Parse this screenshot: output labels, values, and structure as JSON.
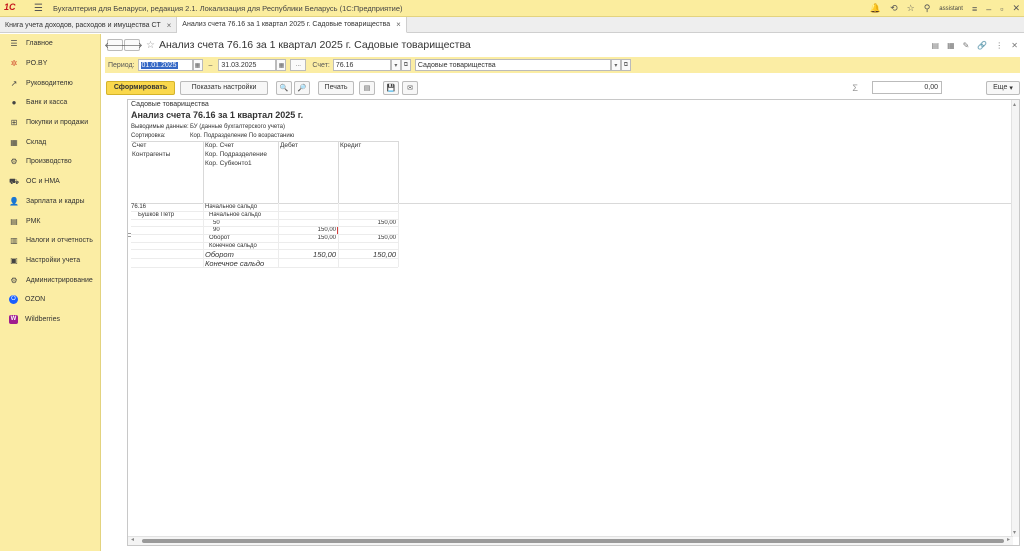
{
  "app": {
    "logo": "1С",
    "title": "Бухгалтерия для Беларуси, редакция 2.1. Локализация для Республики Беларусь   (1С:Предприятие)",
    "user": "assistant"
  },
  "tabs": [
    {
      "label": "Книга учета доходов, расходов и имущества СТ"
    },
    {
      "label": "Анализ счета 76.16 за 1 квартал 2025 г. Садовые товарищества"
    }
  ],
  "sidebar": {
    "items": [
      {
        "label": "Главное",
        "icon": "menu-icon"
      },
      {
        "label": "PO.BY",
        "icon": "sun-icon"
      },
      {
        "label": "Руководителю",
        "icon": "chart-icon"
      },
      {
        "label": "Банк и касса",
        "icon": "bank-icon"
      },
      {
        "label": "Покупки и продажи",
        "icon": "cart-icon"
      },
      {
        "label": "Склад",
        "icon": "warehouse-icon"
      },
      {
        "label": "Производство",
        "icon": "factory-icon"
      },
      {
        "label": "ОС и НМА",
        "icon": "truck-icon"
      },
      {
        "label": "Зарплата и кадры",
        "icon": "person-icon"
      },
      {
        "label": "РМК",
        "icon": "register-icon"
      },
      {
        "label": "Налоги и отчетность",
        "icon": "tax-icon"
      },
      {
        "label": "Настройки учета",
        "icon": "settings-book-icon"
      },
      {
        "label": "Администрирование",
        "icon": "gear-icon"
      },
      {
        "label": "OZON",
        "icon": "ozon-icon"
      },
      {
        "label": "Wildberries",
        "icon": "wb-icon"
      }
    ]
  },
  "header": {
    "title": "Анализ счета 76.16 за 1 квартал 2025 г. Садовые товарищества"
  },
  "params": {
    "period_label": "Период:",
    "date_from": "01.01.2025",
    "dash": "–",
    "date_to": "31.03.2025",
    "ellipsis": "...",
    "account_label": "Счет:",
    "account": "76.16",
    "organization": "Садовые товарищества"
  },
  "toolbar": {
    "generate": "Сформировать",
    "show_settings": "Показать настройки",
    "print": "Печать",
    "sigma": "Σ",
    "sum_value": "0,00",
    "more": "Еще"
  },
  "report": {
    "organization": "Садовые товарищества",
    "title": "Анализ счета 76.16 за 1 квартал 2025 г.",
    "output_label": "Выводимые данные:",
    "output_value": "БУ (данные бухгалтерского учета)",
    "sort_label": "Сортировка:",
    "sort_value": "Кор. Подразделение По возрастанию",
    "col_account": "Счет",
    "col_contractors": "Контрагенты",
    "col_cor_account": "Кор. Счет",
    "col_cor_division": "Кор. Подразделение",
    "col_cor_subconto": "Кор. Субконто1",
    "col_debit": "Дебет",
    "col_credit": "Кредит",
    "rows": {
      "acc": "76.16",
      "acc_open_label": "Начальное сальдо",
      "contractor": "Бушков Петр",
      "c_open_label": "Начальное сальдо",
      "r50_code": "50",
      "r50_credit": "150,00",
      "r90_code": "90",
      "r90_debit": "150,00",
      "turnover_label": "Оборот",
      "turnover_debit": "150,00",
      "turnover_credit": "150,00",
      "closing_label": "Конечное сальдо",
      "total_turnover_label": "Оборот",
      "total_turnover_debit": "150,00",
      "total_turnover_credit": "150,00",
      "total_closing_label": "Конечное сальдо"
    }
  }
}
